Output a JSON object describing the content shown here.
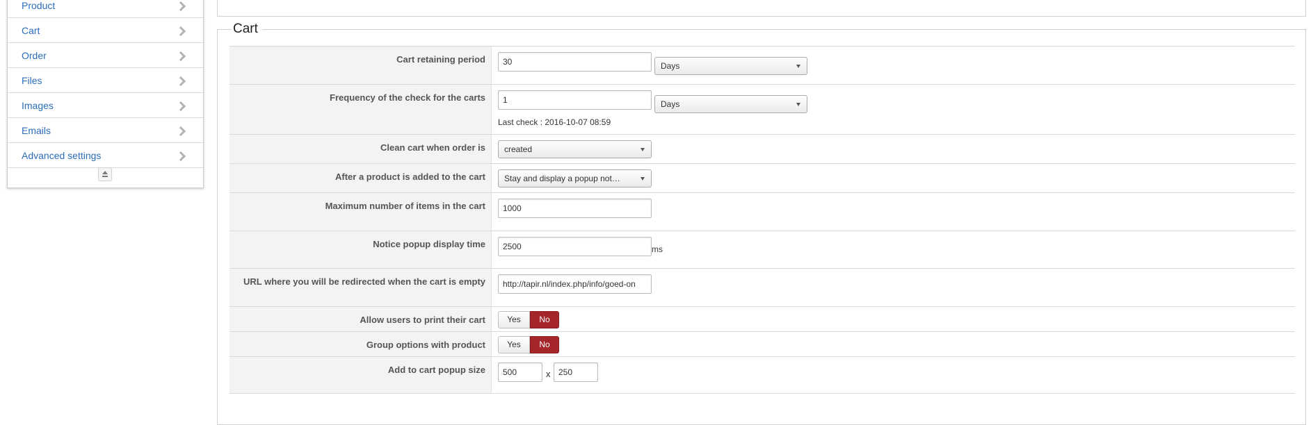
{
  "sidebar": {
    "items": [
      {
        "label": "Product"
      },
      {
        "label": "Cart"
      },
      {
        "label": "Order"
      },
      {
        "label": "Files"
      },
      {
        "label": "Images"
      },
      {
        "label": "Emails"
      },
      {
        "label": "Advanced settings"
      }
    ]
  },
  "cart": {
    "legend": "Cart",
    "retaining_period": {
      "label": "Cart retaining period",
      "value": "30",
      "unit": "Days"
    },
    "check_frequency": {
      "label": "Frequency of the check for the carts",
      "value": "1",
      "unit": "Days",
      "last_check": "Last check : 2016-10-07 08:59"
    },
    "clean_cart": {
      "label": "Clean cart when order is",
      "value": "created"
    },
    "after_add": {
      "label": "After a product is added to the cart",
      "value": "Stay and display a popup not…"
    },
    "max_items": {
      "label": "Maximum number of items in the cart",
      "value": "1000"
    },
    "popup_time": {
      "label": "Notice popup display time",
      "value": "2500",
      "unit": "ms"
    },
    "empty_url": {
      "label": "URL where you will be redirected when the cart is empty",
      "value": "http://tapir.nl/index.php/info/goed-on"
    },
    "print_cart": {
      "label": "Allow users to print their cart",
      "yes": "Yes",
      "no": "No",
      "selected": "No"
    },
    "group_options": {
      "label": "Group options with product",
      "yes": "Yes",
      "no": "No",
      "selected": "No"
    },
    "popup_size": {
      "label": "Add to cart popup size",
      "width": "500",
      "separator": "x",
      "height": "250"
    }
  }
}
